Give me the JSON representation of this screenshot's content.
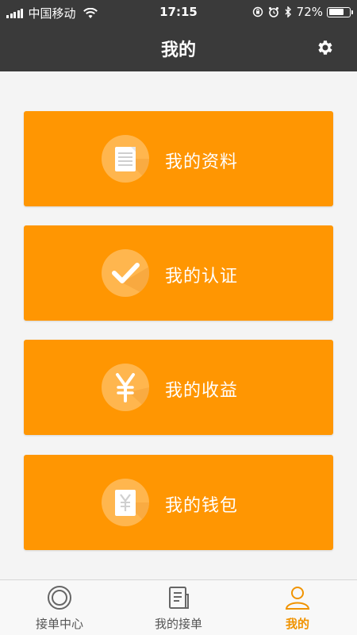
{
  "status_bar": {
    "carrier": "中国移动",
    "time": "17:15",
    "battery_percent": "72%",
    "battery_level": 0.72
  },
  "header": {
    "title": "我的",
    "settings_icon": "gear-icon"
  },
  "menu": [
    {
      "label": "我的资料",
      "icon": "document-icon"
    },
    {
      "label": "我的认证",
      "icon": "checkmark-icon"
    },
    {
      "label": "我的收益",
      "icon": "yen-icon"
    },
    {
      "label": "我的钱包",
      "icon": "wallet-icon"
    }
  ],
  "tabs": [
    {
      "label": "接单中心",
      "icon": "circle-target-icon",
      "active": false
    },
    {
      "label": "我的接单",
      "icon": "list-document-icon",
      "active": false
    },
    {
      "label": "我的",
      "icon": "person-icon",
      "active": true
    }
  ],
  "colors": {
    "header_bg": "#3a3a3a",
    "card_bg": "#ff9602",
    "icon_circle": "#ffb64e",
    "accent": "#f09300",
    "page_bg": "#f4f4f4"
  }
}
